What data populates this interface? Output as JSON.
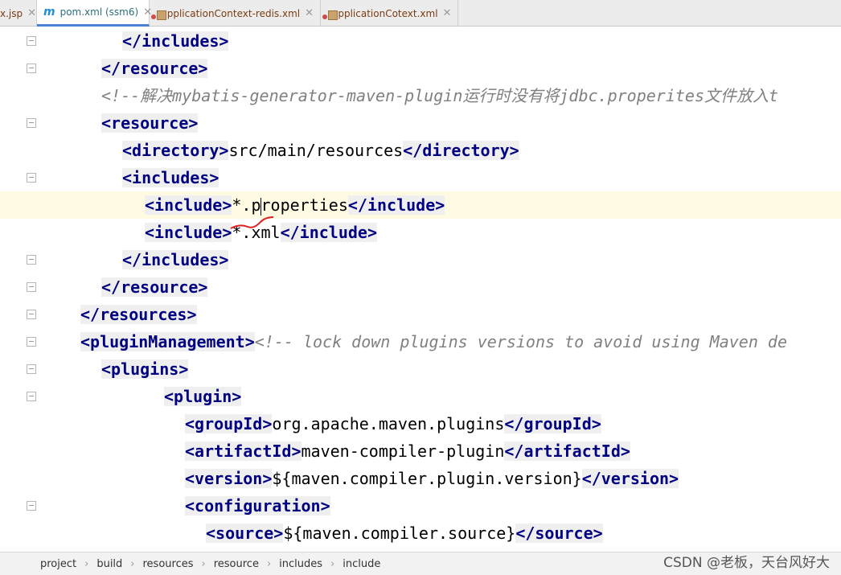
{
  "tabs": [
    {
      "label": "x.jsp",
      "active": false
    },
    {
      "label": "pom.xml (ssm6)",
      "active": true
    },
    {
      "label": "applicationContext-redis.xml",
      "active": false
    },
    {
      "label": "applicationCotext.xml",
      "active": false
    }
  ],
  "code": {
    "l1": "</includes>",
    "l2": "</resource>",
    "l3": "<!--解决mybatis-generator-maven-plugin运行时没有将jdbc.properites文件放入t",
    "l4": "<resource>",
    "l5_open": "<directory>",
    "l5_text": "src/main/resources",
    "l5_close": "</directory>",
    "l6": "<includes>",
    "l7_open": "<include>",
    "l7_text_a": "*.p",
    "l7_text_b": "roperties",
    "l7_close": "</include>",
    "l8_open": "<include>",
    "l8_text": "*.xml",
    "l8_close": "</include>",
    "l9": "</includes>",
    "l10": "</resource>",
    "l11": "</resources>",
    "l12_open": "<pluginManagement>",
    "l12_comment": "<!-- lock down plugins versions to avoid using Maven de",
    "l13": "<plugins>",
    "l14": "<plugin>",
    "l15_open": "<groupId>",
    "l15_text": "org.apache.maven.plugins",
    "l15_close": "</groupId>",
    "l16_open": "<artifactId>",
    "l16_text": "maven-compiler-plugin",
    "l16_close": "</artifactId>",
    "l17_open": "<version>",
    "l17_text": "${maven.compiler.plugin.version}",
    "l17_close": "</version>",
    "l18": "<configuration>",
    "l19_open": "<source>",
    "l19_text": "${maven.compiler.source}",
    "l19_close": "</source>"
  },
  "breadcrumb": [
    "project",
    "build",
    "resources",
    "resource",
    "includes",
    "include"
  ],
  "watermark": "CSDN @老板，天台风好大",
  "colors": {
    "tag": "#000080",
    "comment": "#808080",
    "current_line": "#fffbe3",
    "annotation": "#e02020"
  }
}
